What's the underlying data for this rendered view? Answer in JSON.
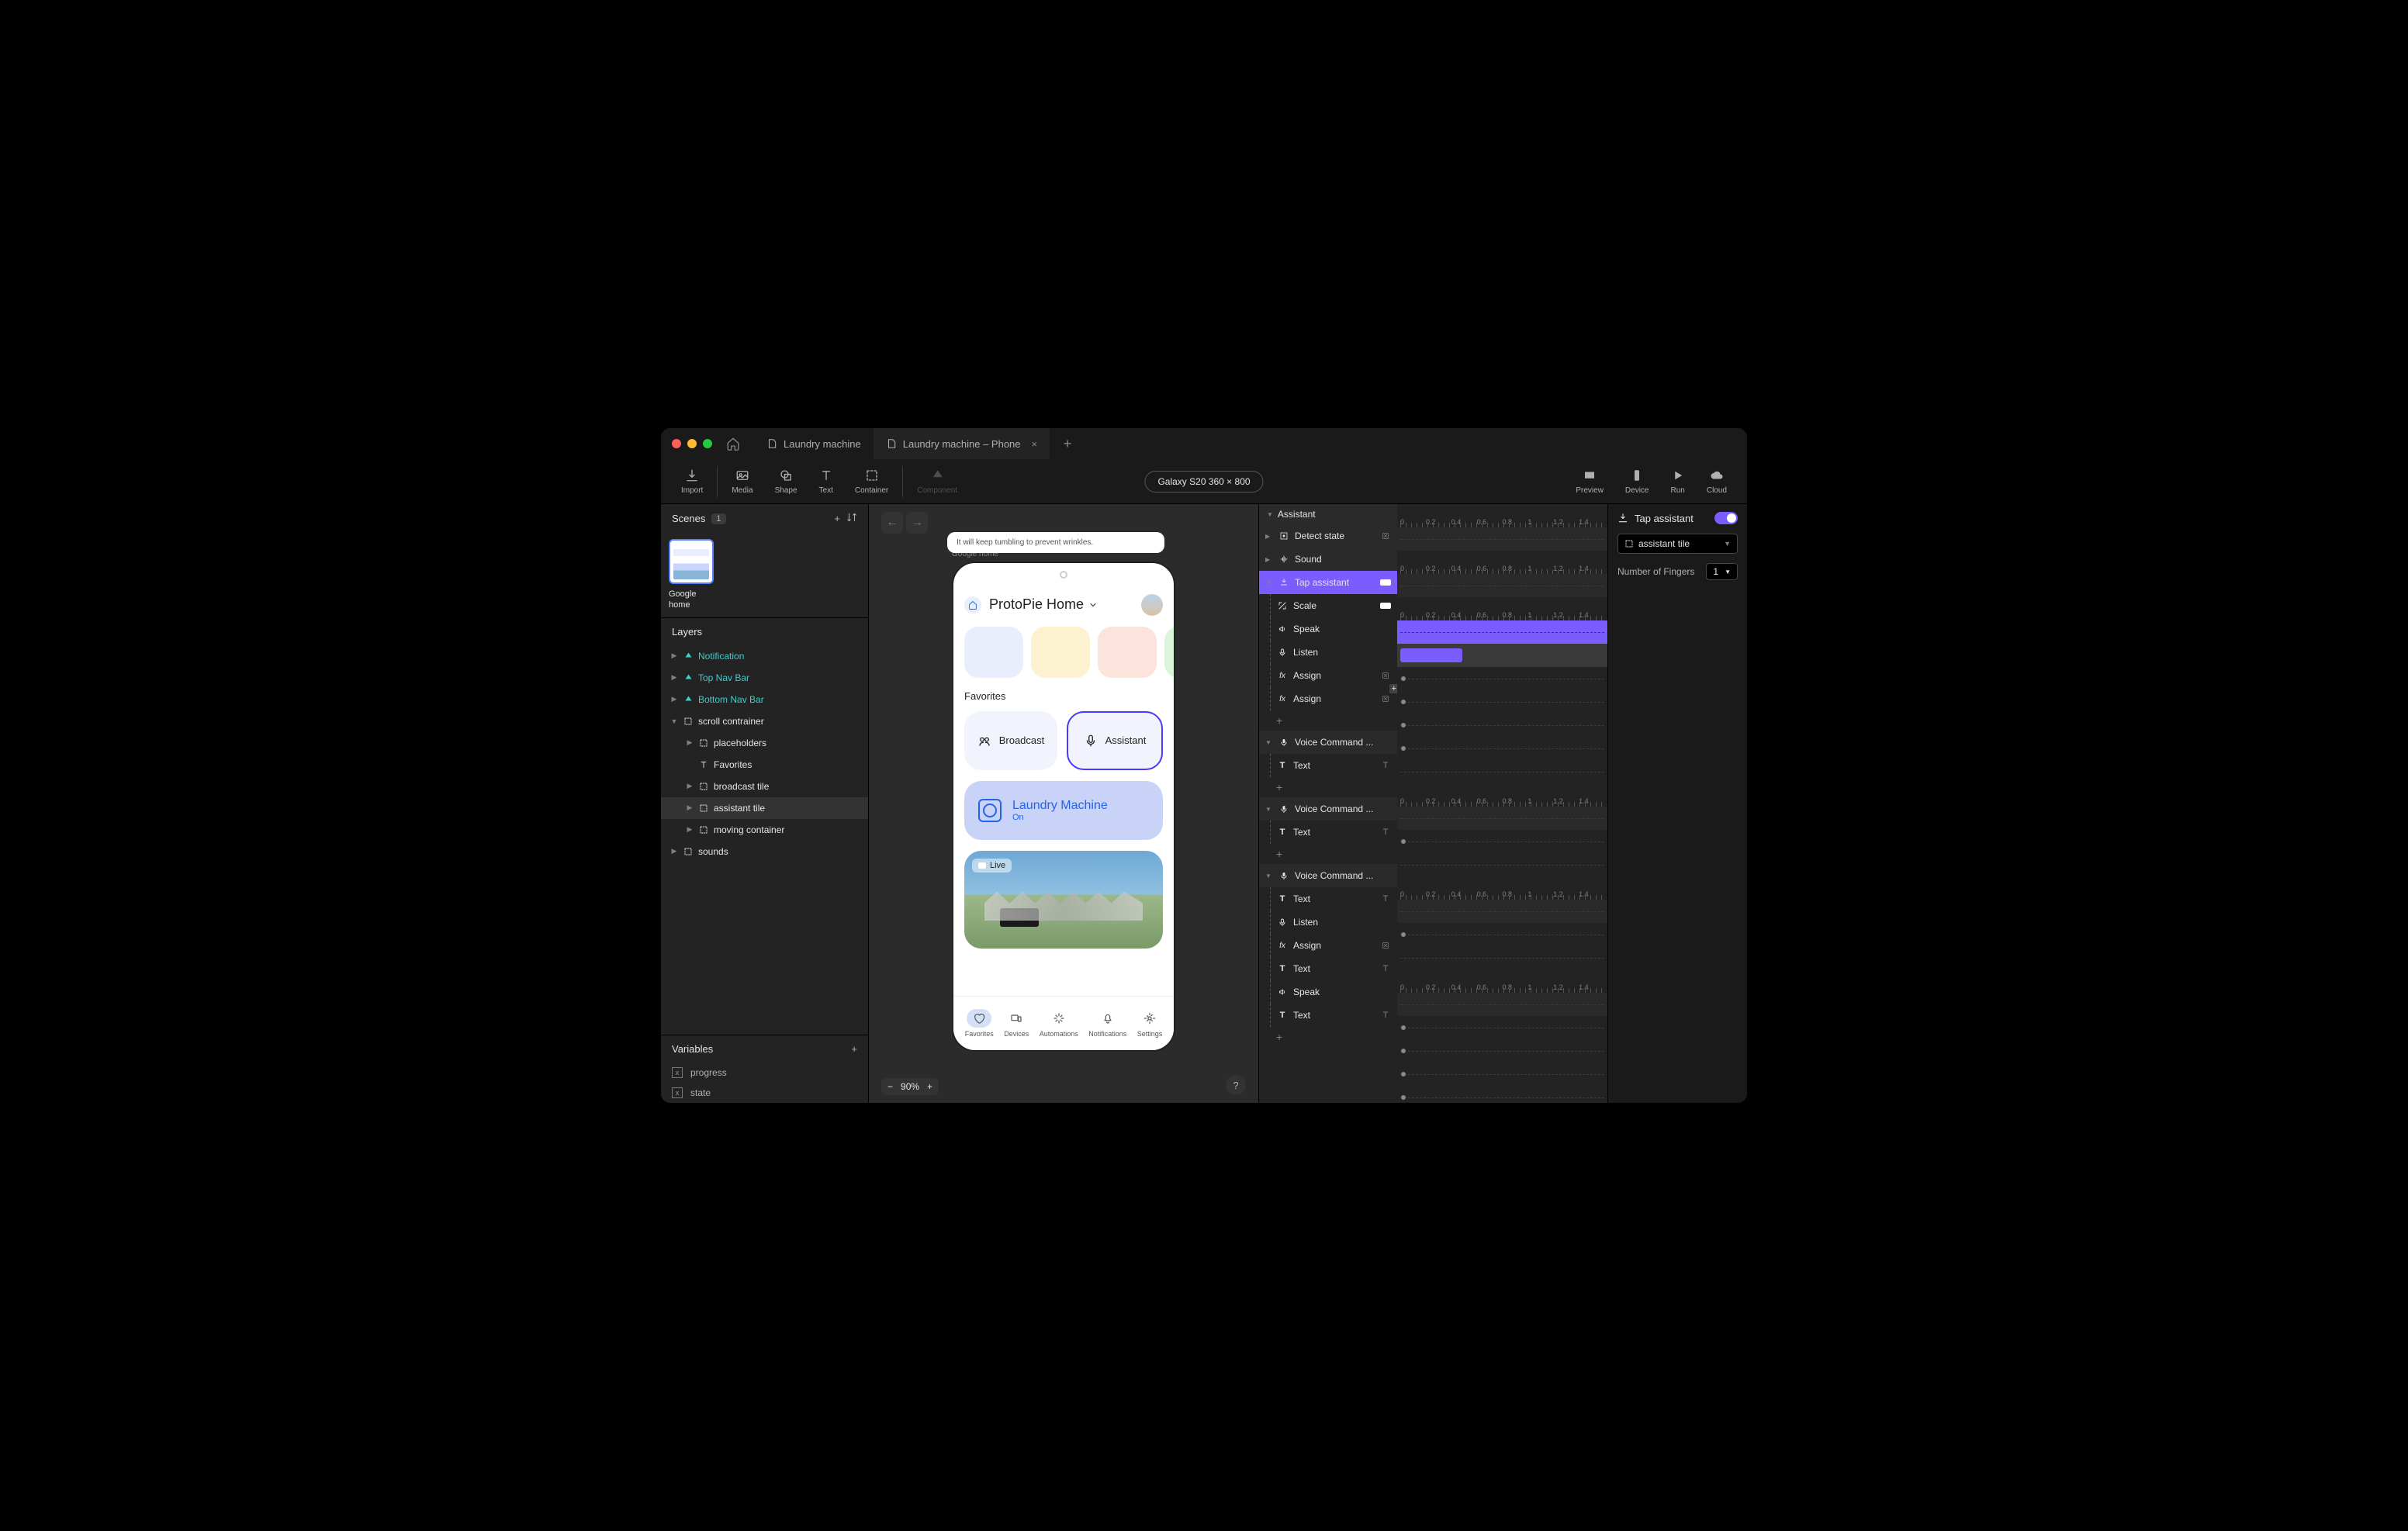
{
  "tabs": [
    {
      "label": "Laundry machine"
    },
    {
      "label": "Laundry machine – Phone",
      "active": true
    }
  ],
  "toolbar": {
    "import": "Import",
    "media": "Media",
    "shape": "Shape",
    "text": "Text",
    "container": "Container",
    "component": "Component",
    "preview": "Preview",
    "device": "Device",
    "run": "Run",
    "cloud": "Cloud"
  },
  "device": "Galaxy S20  360 × 800",
  "scenes": {
    "title": "Scenes",
    "count": "1",
    "items": [
      {
        "label": "Google home"
      }
    ]
  },
  "layers": {
    "title": "Layers",
    "items": [
      {
        "label": "Notification",
        "type": "comp",
        "depth": 0
      },
      {
        "label": "Top Nav Bar",
        "type": "comp",
        "depth": 0
      },
      {
        "label": "Bottom Nav Bar",
        "type": "comp",
        "depth": 0
      },
      {
        "label": "scroll contrainer",
        "type": "container",
        "depth": 0,
        "open": true
      },
      {
        "label": "placeholders",
        "type": "container",
        "depth": 1
      },
      {
        "label": "Favorites",
        "type": "text",
        "depth": 1,
        "noarrow": true
      },
      {
        "label": "broadcast tile",
        "type": "container",
        "depth": 1
      },
      {
        "label": "assistant tile",
        "type": "container",
        "depth": 1,
        "sel": true
      },
      {
        "label": "moving container",
        "type": "container",
        "depth": 1
      },
      {
        "label": "sounds",
        "type": "container",
        "depth": 0
      }
    ]
  },
  "variables": {
    "title": "Variables",
    "items": [
      "progress",
      "state"
    ]
  },
  "canvas": {
    "zoom": "90%",
    "notif": "It will keep tumbling to prevent wrinkles.",
    "scene_label": "Google home",
    "phone": {
      "header": "ProtoPie Home",
      "favorites": "Favorites",
      "broadcast": "Broadcast",
      "assistant": "Assistant",
      "laundry": {
        "title": "Laundry Machine",
        "sub": "On"
      },
      "live": "Live",
      "nav": [
        "Favorites",
        "Devices",
        "Automations",
        "Notifications",
        "Settings"
      ]
    }
  },
  "interactions": {
    "header": "Assistant",
    "ruler": [
      "0",
      "0.2",
      "0.4",
      "0.6",
      "0.8",
      "1",
      "1.2",
      "1.4"
    ],
    "groups": [
      {
        "trigger": {
          "label": "Detect state",
          "icon": "detect",
          "end": "x"
        },
        "responses": [],
        "collapsed": true
      },
      {
        "trigger": {
          "label": "Sound",
          "icon": "sound"
        },
        "responses": [],
        "collapsed": true
      },
      {
        "trigger": {
          "label": "Tap assistant",
          "icon": "tap",
          "end": "badge",
          "sel": true
        },
        "responses": [
          {
            "label": "Scale",
            "icon": "scale",
            "end": "badge",
            "bar": true
          },
          {
            "label": "Speak",
            "icon": "speak"
          },
          {
            "label": "Listen",
            "icon": "mic"
          },
          {
            "label": "Assign",
            "icon": "fx",
            "end": "x",
            "plus": true
          },
          {
            "label": "Assign",
            "icon": "fx",
            "end": "x"
          }
        ]
      },
      {
        "trigger": {
          "label": "Voice Command ...",
          "icon": "mic2"
        },
        "responses": [
          {
            "label": "Text",
            "icon": "T",
            "end": "T"
          }
        ]
      },
      {
        "trigger": {
          "label": "Voice Command ...",
          "icon": "mic2"
        },
        "responses": [
          {
            "label": "Text",
            "icon": "T",
            "end": "T"
          }
        ]
      },
      {
        "trigger": {
          "label": "Voice Command ...",
          "icon": "mic2"
        },
        "responses": [
          {
            "label": "Text",
            "icon": "T",
            "end": "T"
          },
          {
            "label": "Listen",
            "icon": "mic"
          },
          {
            "label": "Assign",
            "icon": "fx",
            "end": "x"
          },
          {
            "label": "Text",
            "icon": "T",
            "end": "T"
          },
          {
            "label": "Speak",
            "icon": "speak"
          },
          {
            "label": "Text",
            "icon": "T",
            "end": "T"
          }
        ]
      }
    ]
  },
  "props": {
    "title": "Tap assistant",
    "target": "assistant tile",
    "fingers_label": "Number of Fingers",
    "fingers": "1"
  }
}
